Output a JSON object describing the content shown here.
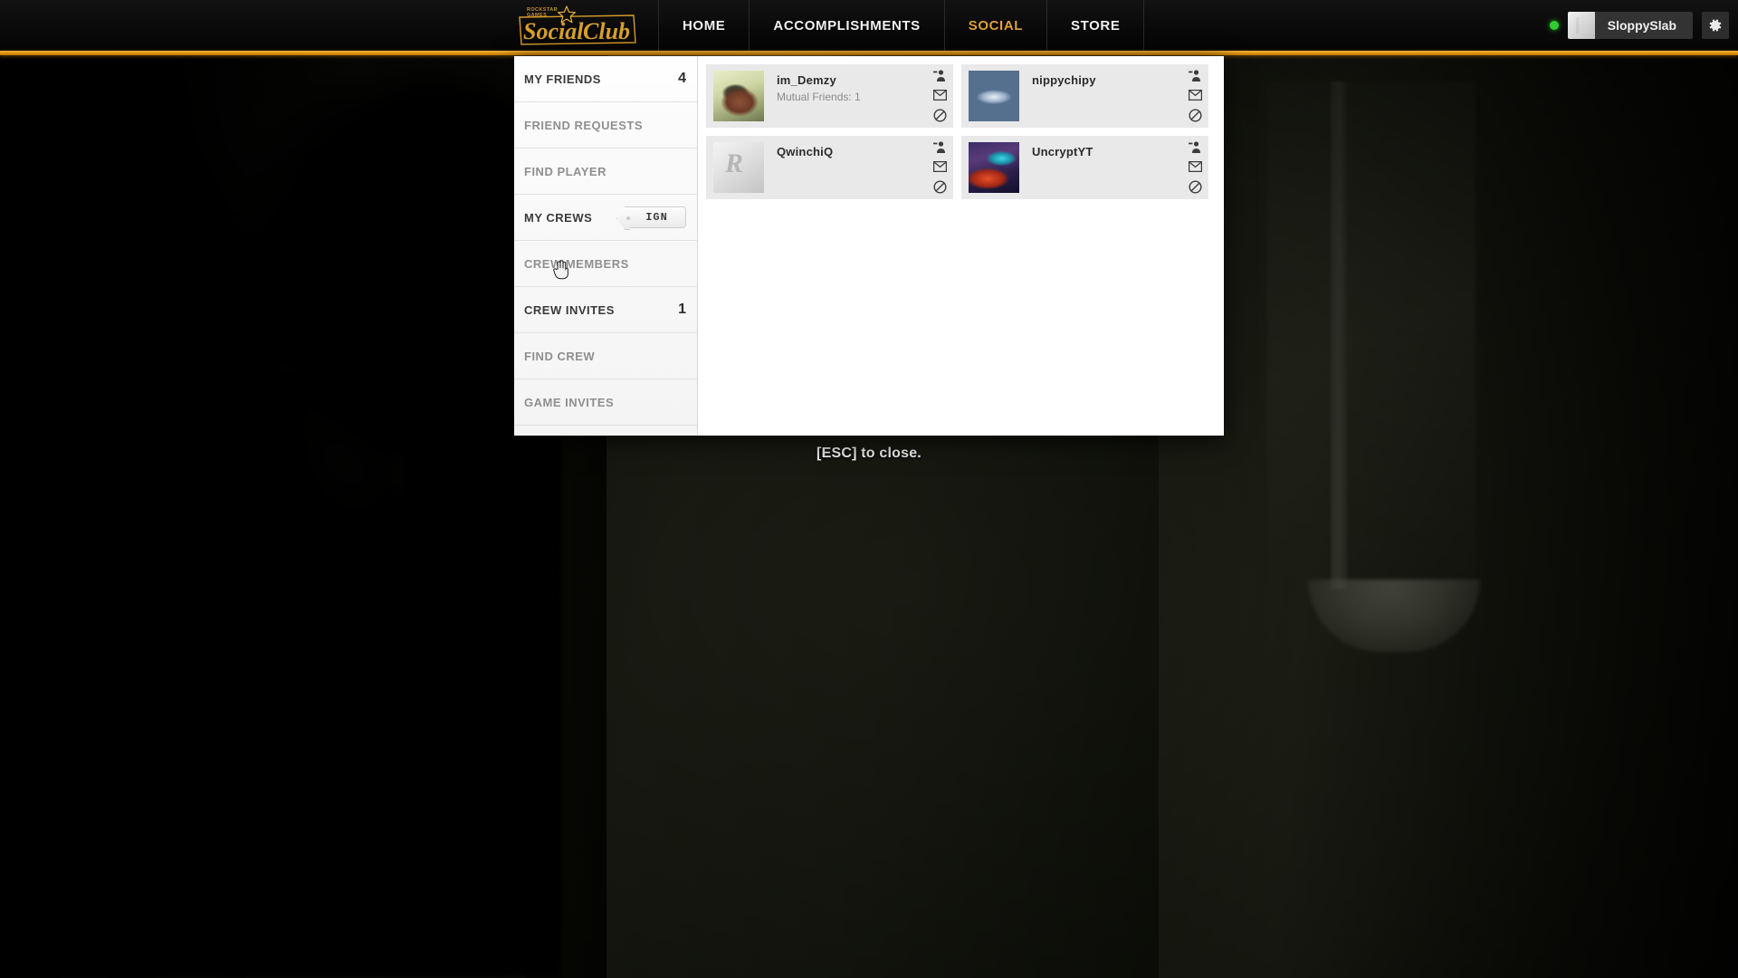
{
  "header": {
    "logo_alt": "Rockstar Games Social Club",
    "logo_top_line1": "ROCKSTAR",
    "logo_top_line2": "GAMES",
    "logo_word1": "Social",
    "logo_word2": "Club",
    "nav": [
      {
        "label": "HOME",
        "active": false
      },
      {
        "label": "ACCOMPLISHMENTS",
        "active": false
      },
      {
        "label": "SOCIAL",
        "active": true
      },
      {
        "label": "STORE",
        "active": false
      }
    ],
    "user": {
      "name": "SloppySlab",
      "status": "online",
      "status_color": "#2ecc2e",
      "settings_icon": "gear-icon",
      "avatar_icon": "user-avatar"
    },
    "accent_color": "#e29512"
  },
  "sidebar": {
    "items": [
      {
        "label": "MY FRIENDS",
        "count": "4",
        "badge": "",
        "active": true
      },
      {
        "label": "FRIEND REQUESTS",
        "count": "",
        "badge": "",
        "active": false
      },
      {
        "label": "FIND PLAYER",
        "count": "",
        "badge": "",
        "active": false
      },
      {
        "label": "MY CREWS",
        "count": "",
        "badge": "IGN",
        "active": true
      },
      {
        "label": "CREW MEMBERS",
        "count": "",
        "badge": "",
        "active": false
      },
      {
        "label": "CREW INVITES",
        "count": "1",
        "badge": "",
        "active": true
      },
      {
        "label": "FIND CREW",
        "count": "",
        "badge": "",
        "active": false
      },
      {
        "label": "GAME INVITES",
        "count": "",
        "badge": "",
        "active": false
      }
    ]
  },
  "friends": [
    {
      "name": "im_Demzy",
      "subtitle": "Mutual Friends: 1",
      "avatar": "dog-avatar",
      "actions": [
        "remove-friend-icon",
        "message-icon",
        "block-icon"
      ]
    },
    {
      "name": "nippychipy",
      "subtitle": "",
      "avatar": "goggles-avatar",
      "actions": [
        "remove-friend-icon",
        "message-icon",
        "block-icon"
      ]
    },
    {
      "name": "QwinchiQ",
      "subtitle": "",
      "avatar": "rockstar-default-avatar",
      "actions": [
        "remove-friend-icon",
        "message-icon",
        "block-icon"
      ]
    },
    {
      "name": "UncryptYT",
      "subtitle": "",
      "avatar": "car-avatar",
      "actions": [
        "remove-friend-icon",
        "message-icon",
        "block-icon"
      ]
    }
  ],
  "footer": {
    "esc_hint": "[ESC] to close."
  }
}
